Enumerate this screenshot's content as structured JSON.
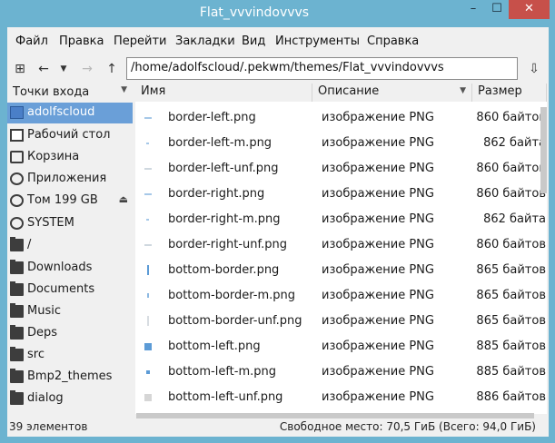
{
  "window": {
    "title": "Flat_vvvindovvvs",
    "controls": {
      "minimize": "–",
      "maximize": "☐",
      "close": "✕"
    }
  },
  "menu": [
    "Файл",
    "Правка",
    "Перейти",
    "Закладки",
    "Вид",
    "Инструменты",
    "Справка"
  ],
  "toolbar": {
    "path": "/home/adolfscloud/.pekwm/themes/Flat_vvvindovvvs"
  },
  "sidebar": {
    "header": "Точки входа",
    "items": [
      {
        "label": "adolfscloud",
        "icon": "home-icon",
        "selected": true
      },
      {
        "label": "Рабочий стол",
        "icon": "desktop-icon"
      },
      {
        "label": "Корзина",
        "icon": "trash-icon"
      },
      {
        "label": "Приложения",
        "icon": "applications-icon"
      },
      {
        "label": "Том 199 GB",
        "icon": "drive-icon",
        "eject": true
      },
      {
        "label": "SYSTEM",
        "icon": "drive-icon"
      },
      {
        "label": "/",
        "icon": "folder-icon"
      },
      {
        "label": "Downloads",
        "icon": "folder-icon"
      },
      {
        "label": "Documents",
        "icon": "folder-icon"
      },
      {
        "label": "Music",
        "icon": "folder-icon"
      },
      {
        "label": "Deps",
        "icon": "folder-icon"
      },
      {
        "label": "src",
        "icon": "folder-icon"
      },
      {
        "label": "Bmp2_themes",
        "icon": "folder-icon"
      },
      {
        "label": "dialog",
        "icon": "folder-icon"
      }
    ]
  },
  "columns": {
    "name": "Имя",
    "description": "Описание",
    "size": "Размер"
  },
  "files": [
    {
      "name": "border-left.png",
      "description": "изображение PNG",
      "size": "860 байтов",
      "thumb": "hline"
    },
    {
      "name": "border-left-m.png",
      "description": "изображение PNG",
      "size": "862 байта",
      "thumb": "dash"
    },
    {
      "name": "border-left-unf.png",
      "description": "изображение PNG",
      "size": "860 байтов",
      "thumb": "hline-faint"
    },
    {
      "name": "border-right.png",
      "description": "изображение PNG",
      "size": "860 байтов",
      "thumb": "hline"
    },
    {
      "name": "border-right-m.png",
      "description": "изображение PNG",
      "size": "862 байта",
      "thumb": "dash"
    },
    {
      "name": "border-right-unf.png",
      "description": "изображение PNG",
      "size": "860 байтов",
      "thumb": "hline-faint"
    },
    {
      "name": "bottom-border.png",
      "description": "изображение PNG",
      "size": "865 байтов",
      "thumb": "vline"
    },
    {
      "name": "bottom-border-m.png",
      "description": "изображение PNG",
      "size": "865 байтов",
      "thumb": "vdash"
    },
    {
      "name": "bottom-border-unf.png",
      "description": "изображение PNG",
      "size": "865 байтов",
      "thumb": "vline-faint"
    },
    {
      "name": "bottom-left.png",
      "description": "изображение PNG",
      "size": "885 байтов",
      "thumb": "square"
    },
    {
      "name": "bottom-left-m.png",
      "description": "изображение PNG",
      "size": "885 байтов",
      "thumb": "dot"
    },
    {
      "name": "bottom-left-unf.png",
      "description": "изображение PNG",
      "size": "886 байтов",
      "thumb": "square-faint"
    }
  ],
  "colors": {
    "accent": "#5c9bd6",
    "selection": "#6a9fd8",
    "titlebar": "#6cb3d0",
    "close": "#c7504a"
  },
  "status": {
    "count": "39 элементов",
    "free": "Свободное место: 70,5 ГиБ (Всего: 94,0 ГиБ)"
  }
}
